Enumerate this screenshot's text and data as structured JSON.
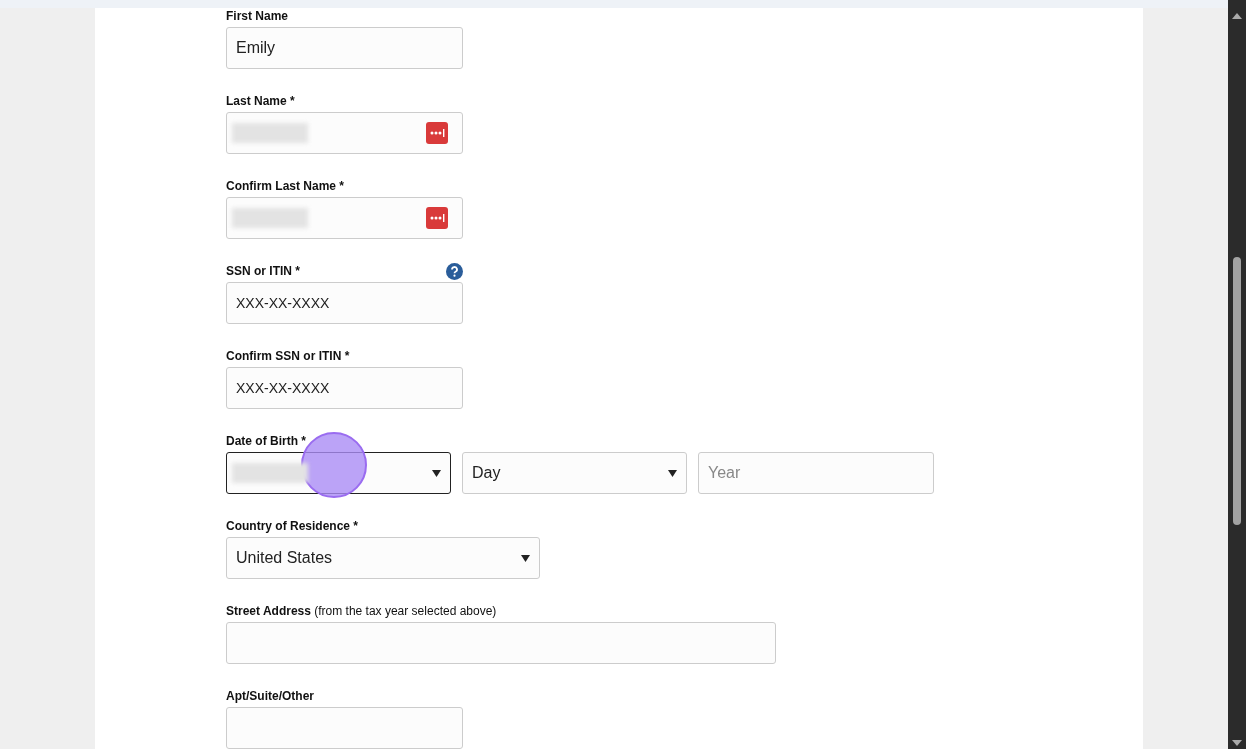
{
  "form": {
    "fields": [
      {
        "kind": "text",
        "label": "First Name",
        "value": "Emily"
      },
      {
        "kind": "redacted",
        "label": "Last Name *",
        "password_icon": true
      },
      {
        "kind": "redacted",
        "label": "Confirm Last Name *",
        "password_icon": true
      },
      {
        "kind": "text",
        "label": "SSN or ITIN *",
        "placeholder": "XXX-XX-XXXX",
        "help": true
      },
      {
        "kind": "text",
        "label": "Confirm SSN or ITIN *",
        "placeholder": "XXX-XX-XXXX"
      },
      {
        "kind": "date",
        "label": "Date of Birth *",
        "parts": [
          {
            "kind": "select",
            "redacted": true,
            "focused": true
          },
          {
            "kind": "select",
            "value": "Day",
            "focused": false
          },
          {
            "kind": "input",
            "placeholder": "Year"
          }
        ]
      },
      {
        "kind": "select",
        "label": "Country of Residence *",
        "value": "United States"
      },
      {
        "kind": "text",
        "label": "Street Address",
        "note": "(from the tax year selected above)",
        "wide": true
      },
      {
        "kind": "text",
        "label": "Apt/Suite/Other"
      }
    ]
  }
}
